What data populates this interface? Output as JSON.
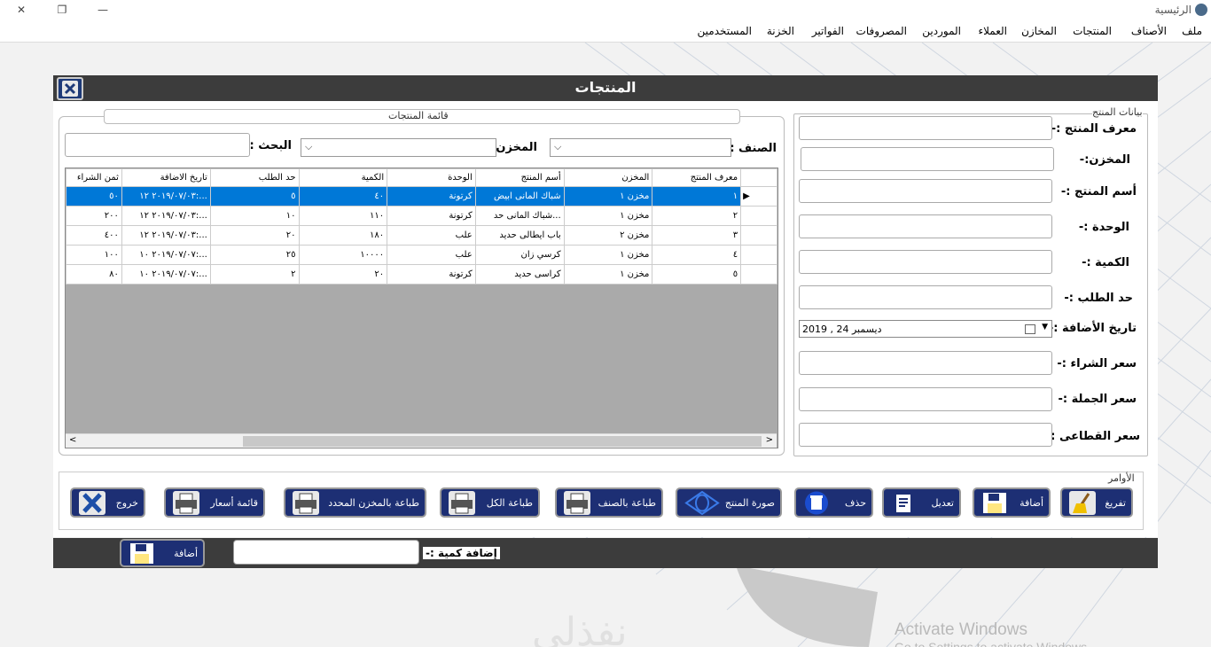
{
  "window": {
    "title": "الرئيسية",
    "minimize_icon": "minimize-icon",
    "maximize_icon": "restore-icon",
    "close_icon": "close-icon"
  },
  "menu": [
    "ملف",
    "الأصناف",
    "المنتجات",
    "المخازن",
    "العملاء",
    "الموردين",
    "المصروفات",
    "الفواتير",
    "الخزنة",
    "المستخدمين"
  ],
  "panel": {
    "title": "المنتجات"
  },
  "list": {
    "legend": "قائمة المنتجات",
    "category_label": "الصنف :-",
    "store_label": "المخزن",
    "search_label": "البحث :-",
    "category_value": "",
    "store_value": "",
    "search_value": "",
    "columns": [
      "ثمن الشراء",
      "تاريخ الاضافة",
      "حد الطلب",
      "الكمية",
      "الوحدة",
      "أسم المنتج",
      "المخزن",
      "معرف المنتج"
    ],
    "rows": [
      [
        "٥٠",
        "٢٠١٩/٠٧/٠٣ ١٢:...",
        "٥",
        "٤٠",
        "كرتونة",
        "شباك المانى ابيض",
        "مخزن ١",
        "١"
      ],
      [
        "٢٠٠",
        "٢٠١٩/٠٧/٠٣ ١٢:...",
        "١٠",
        "١١٠",
        "كرتونة",
        "شباك المانى حد...",
        "مخزن ١",
        "٢"
      ],
      [
        "٤٠٠",
        "٢٠١٩/٠٧/٠٣ ١٢:...",
        "٢٠",
        "١٨٠",
        "علب",
        "باب ايطالى حديد",
        "مخزن ٢",
        "٣"
      ],
      [
        "١٠٠",
        "٢٠١٩/٠٧/٠٧ ١٠:...",
        "٢٥",
        "١٠٠٠٠",
        "علب",
        "كرسي زان",
        "مخزن ١",
        "٤"
      ],
      [
        "٨٠",
        "٢٠١٩/٠٧/٠٧ ١٠:...",
        "٢",
        "٢٠",
        "كرتونة",
        "كراسى حديد",
        "مخزن ١",
        "٥"
      ]
    ],
    "selected_row": 0
  },
  "form": {
    "legend": "بيانات المنتج",
    "fields": [
      {
        "label": "معرف المنتج :-",
        "value": ""
      },
      {
        "label": "المخزن:-",
        "value": ""
      },
      {
        "label": "أسم المنتج :-",
        "value": ""
      },
      {
        "label": "الوحدة :-",
        "value": ""
      },
      {
        "label": "الكمية :-",
        "value": ""
      },
      {
        "label": "حد الطلب :-",
        "value": ""
      },
      {
        "label": "تاريخ الأضافة :-",
        "value": "2019 , ديسمبر  24"
      },
      {
        "label": "سعر الشراء :-",
        "value": ""
      },
      {
        "label": "سعر الجملة :-",
        "value": ""
      },
      {
        "label": "سعر القطاعى :-",
        "value": ""
      }
    ]
  },
  "commands": {
    "legend": "الأوامر",
    "buttons": [
      {
        "label": "تفريغ",
        "icon": "broom-icon",
        "color": "#f0c000"
      },
      {
        "label": "أضافة",
        "icon": "save-icon",
        "color": "#ffe680"
      },
      {
        "label": "تعديل",
        "icon": "edit-icon",
        "color": "#ffffff"
      },
      {
        "label": "حذف",
        "icon": "trash-icon",
        "color": "#ffffff"
      },
      {
        "label": "صورة المنتج",
        "icon": "image-icon",
        "color": "#1a5bd8"
      },
      {
        "label": "طباعة بالصنف",
        "icon": "printer-icon",
        "color": "#e8e8e8"
      },
      {
        "label": "طباعة الكل",
        "icon": "printer-icon",
        "color": "#e8e8e8"
      },
      {
        "label": "طباعة بالمخزن المحدد",
        "icon": "printer-icon",
        "color": "#e8e8e8"
      },
      {
        "label": "قائمة أسعار",
        "icon": "printer-icon",
        "color": "#e8e8e8"
      },
      {
        "label": "خروج",
        "icon": "exit-x-icon",
        "color": "#1d4fa8"
      }
    ]
  },
  "footer": {
    "qty_label": "إضافة كمية :-",
    "qty_value": "",
    "add_label": "أضافة",
    "add_icon": "save-icon"
  },
  "activation": {
    "line1": "Activate Windows",
    "line2": "Go to Settings to activate Windows."
  },
  "colors": {
    "header": "#3c3c3c",
    "selection": "#0078d7",
    "button": "#1d2f74"
  }
}
